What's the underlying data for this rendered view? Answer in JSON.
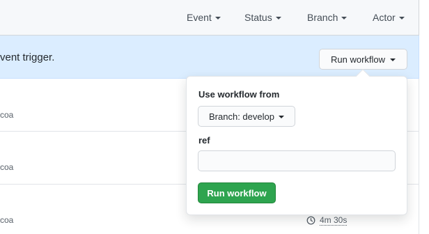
{
  "filters": {
    "event": "Event",
    "status": "Status",
    "branch": "Branch",
    "actor": "Actor"
  },
  "banner": {
    "text": "vent trigger.",
    "run_button": "Run workflow"
  },
  "rows": [
    {
      "text": "coa"
    },
    {
      "text": "coa"
    },
    {
      "text": "coa",
      "duration": "4m 30s"
    }
  ],
  "popover": {
    "use_label": "Use workflow from",
    "branch_button": "Branch: develop",
    "ref_label": "ref",
    "ref_value": "",
    "submit_label": "Run workflow"
  },
  "colors": {
    "accent": "#2ea44f",
    "banner_bg": "#dbedff"
  }
}
